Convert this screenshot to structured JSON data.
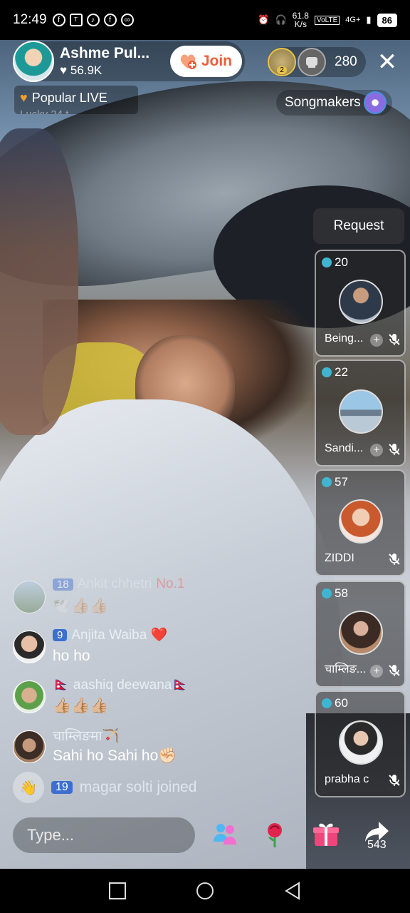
{
  "status_bar": {
    "time": "12:49",
    "net_speed_value": "61.8",
    "net_speed_unit": "K/s",
    "volte": "VoLTE",
    "network": "4G+",
    "battery": "86"
  },
  "host": {
    "name": "Ashme Pul...",
    "likes": "56.9K",
    "join_label": "Join"
  },
  "viewers": {
    "badge_rank": "2",
    "count": "280"
  },
  "close_label": "✕",
  "popular_live": {
    "label": "Popular LIVE",
    "second_line": "Lucky  24  t"
  },
  "songmakers_label": "Songmakers",
  "request_label": "Request",
  "guests": [
    {
      "level": "20",
      "name": "Being..."
    },
    {
      "level": "22",
      "name": "Sandi..."
    },
    {
      "level": "57",
      "name": "ZIDDI"
    },
    {
      "level": "58",
      "name": "चाम्लिङ..."
    },
    {
      "level": "60",
      "name": "prabha c..."
    }
  ],
  "comments": [
    {
      "level": "18",
      "user": "Ankit  chhetri",
      "badge": "No.1",
      "text": "🕊️👍🏼👍🏼"
    },
    {
      "level": "9",
      "user": "Anjita Waiba ❤️",
      "badge": "",
      "text": "ho ho"
    },
    {
      "level": "",
      "user": "🇳🇵 aashiq deewana🇳🇵",
      "badge": "",
      "text": "👍🏼👍🏼👍🏼"
    },
    {
      "level": "",
      "user": "चाम्लिङमा🏹",
      "badge": "",
      "text": "Sahi ho Sahi ho✊🏻"
    }
  ],
  "joined": {
    "level": "19",
    "text": "magar solti  joined"
  },
  "input": {
    "placeholder": "Type..."
  },
  "share_count": "543",
  "colors": {
    "join_text": "#f15b3a",
    "level_badge": "#3d6fd1",
    "guest_level_dot": "#3fb6d1"
  }
}
